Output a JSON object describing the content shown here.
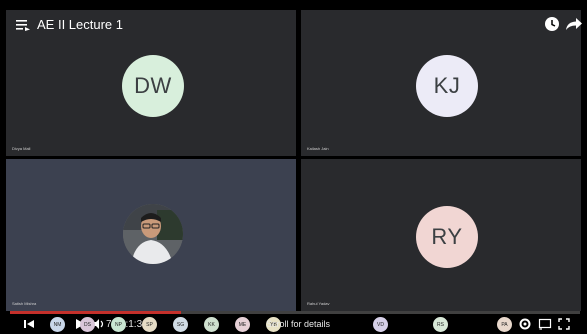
{
  "title": "AE II Lecture 1",
  "icons": {
    "menu": "playlist-icon",
    "clock": "watch-later-icon",
    "share": "share-icon"
  },
  "tiles": [
    {
      "initials": "DW",
      "name": "Divya Mall"
    },
    {
      "initials": "KJ",
      "name": "Kailash Jain"
    },
    {
      "initials": "",
      "name": "Satish Mishra"
    },
    {
      "initials": "RY",
      "name": "Rahul Yadav"
    }
  ],
  "player": {
    "timecode": "7 / 1:1:39",
    "scroll_label": "Scroll for details",
    "progress_fraction": 0.3
  },
  "participant_chips": [
    {
      "initials": "NM",
      "color": "#c9d7ea"
    },
    {
      "initials": "DS",
      "color": "#d9c6d9"
    },
    {
      "initials": "NP",
      "color": "#c9e6d2"
    },
    {
      "initials": "SP",
      "color": "#e6dcc6"
    },
    {
      "initials": "SG",
      "color": "#d2dde6"
    },
    {
      "initials": "KK",
      "color": "#cfe0cf"
    },
    {
      "initials": "ME",
      "color": "#e6d0d6"
    },
    {
      "initials": "YB",
      "color": "#e8e2c5"
    },
    {
      "initials": "VD",
      "color": "#d6d0e8"
    },
    {
      "initials": "RS",
      "color": "#d8e8d8"
    },
    {
      "initials": "PA",
      "color": "#e8d8cc"
    }
  ],
  "colors": {
    "tile_bg": "#292a2d",
    "active_tile_bg": "#3c4150",
    "progress": "#c4302b"
  }
}
